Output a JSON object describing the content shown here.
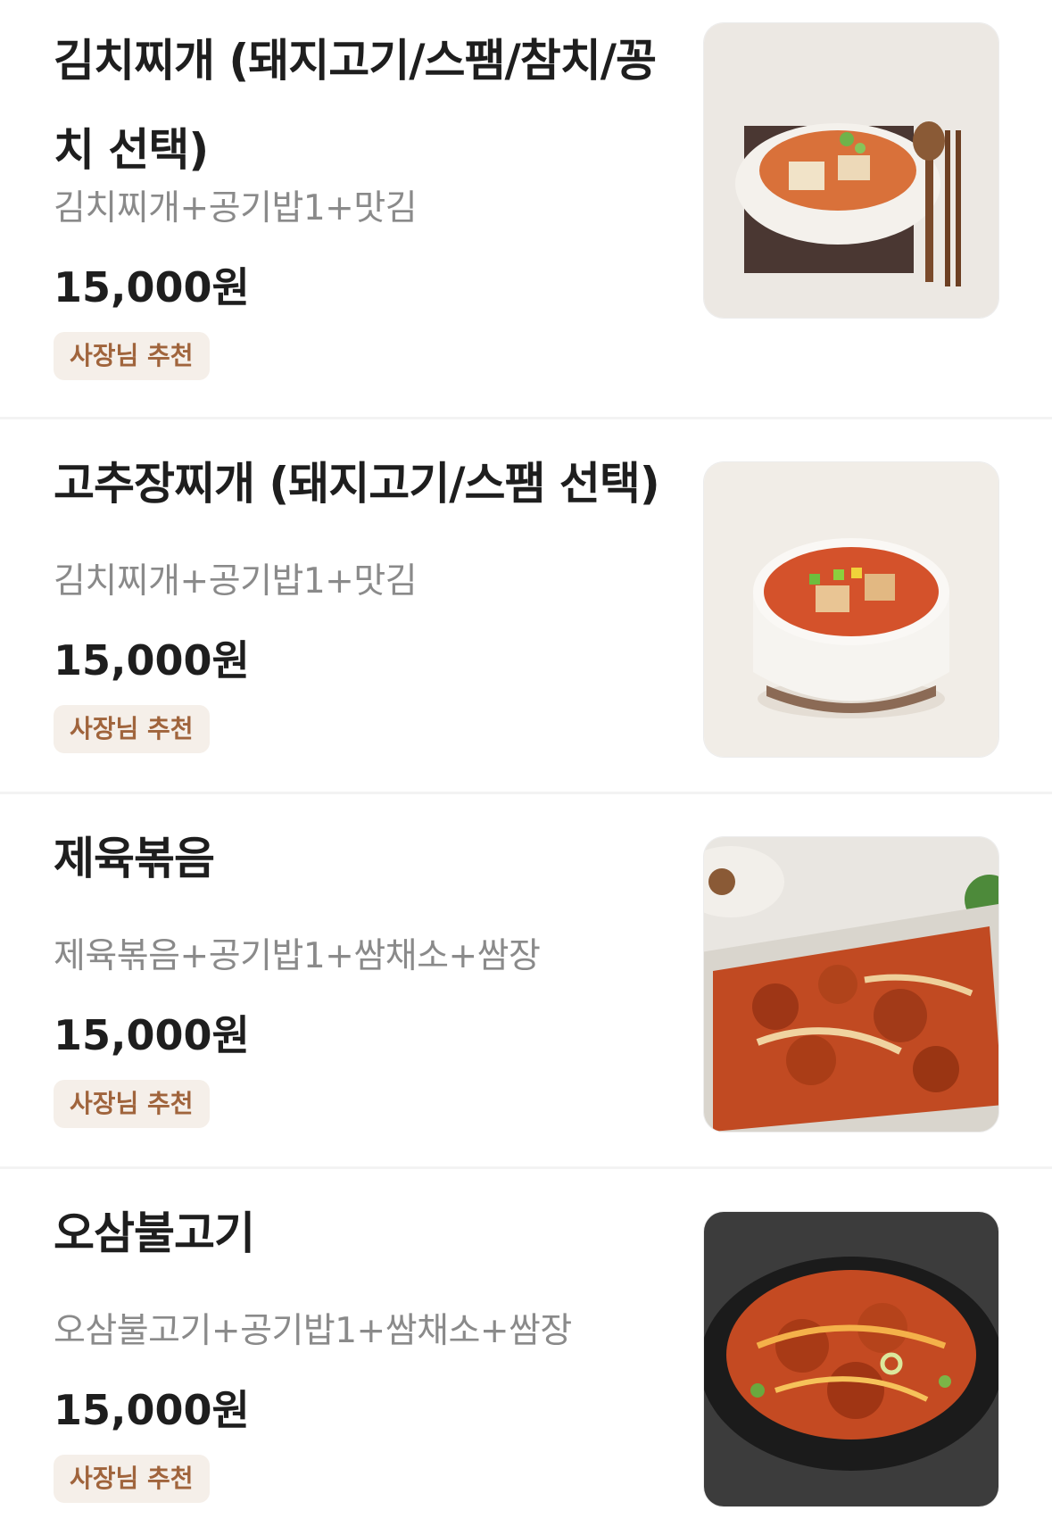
{
  "menu": {
    "items": [
      {
        "title": "김치찌개 (돼지고기/스팸/참치/꽁치 선택)",
        "description": "김치찌개+공기밥1+맛김",
        "price": "15,000원",
        "badge": "사장님 추천",
        "image": "kimchi-stew-photo"
      },
      {
        "title": "고추장찌개 (돼지고기/스팸 선택)",
        "description": "김치찌개+공기밥1+맛김",
        "price": "15,000원",
        "badge": "사장님 추천",
        "image": "gochujang-stew-photo"
      },
      {
        "title": "제육볶음",
        "description": "제육볶음+공기밥1+쌈채소+쌈장",
        "price": "15,000원",
        "badge": "사장님 추천",
        "image": "stir-fried-pork-photo"
      },
      {
        "title": "오삼불고기",
        "description": "오삼불고기+공기밥1+쌈채소+쌈장",
        "price": "15,000원",
        "badge": "사장님 추천",
        "image": "squid-pork-bulgogi-photo"
      }
    ]
  }
}
